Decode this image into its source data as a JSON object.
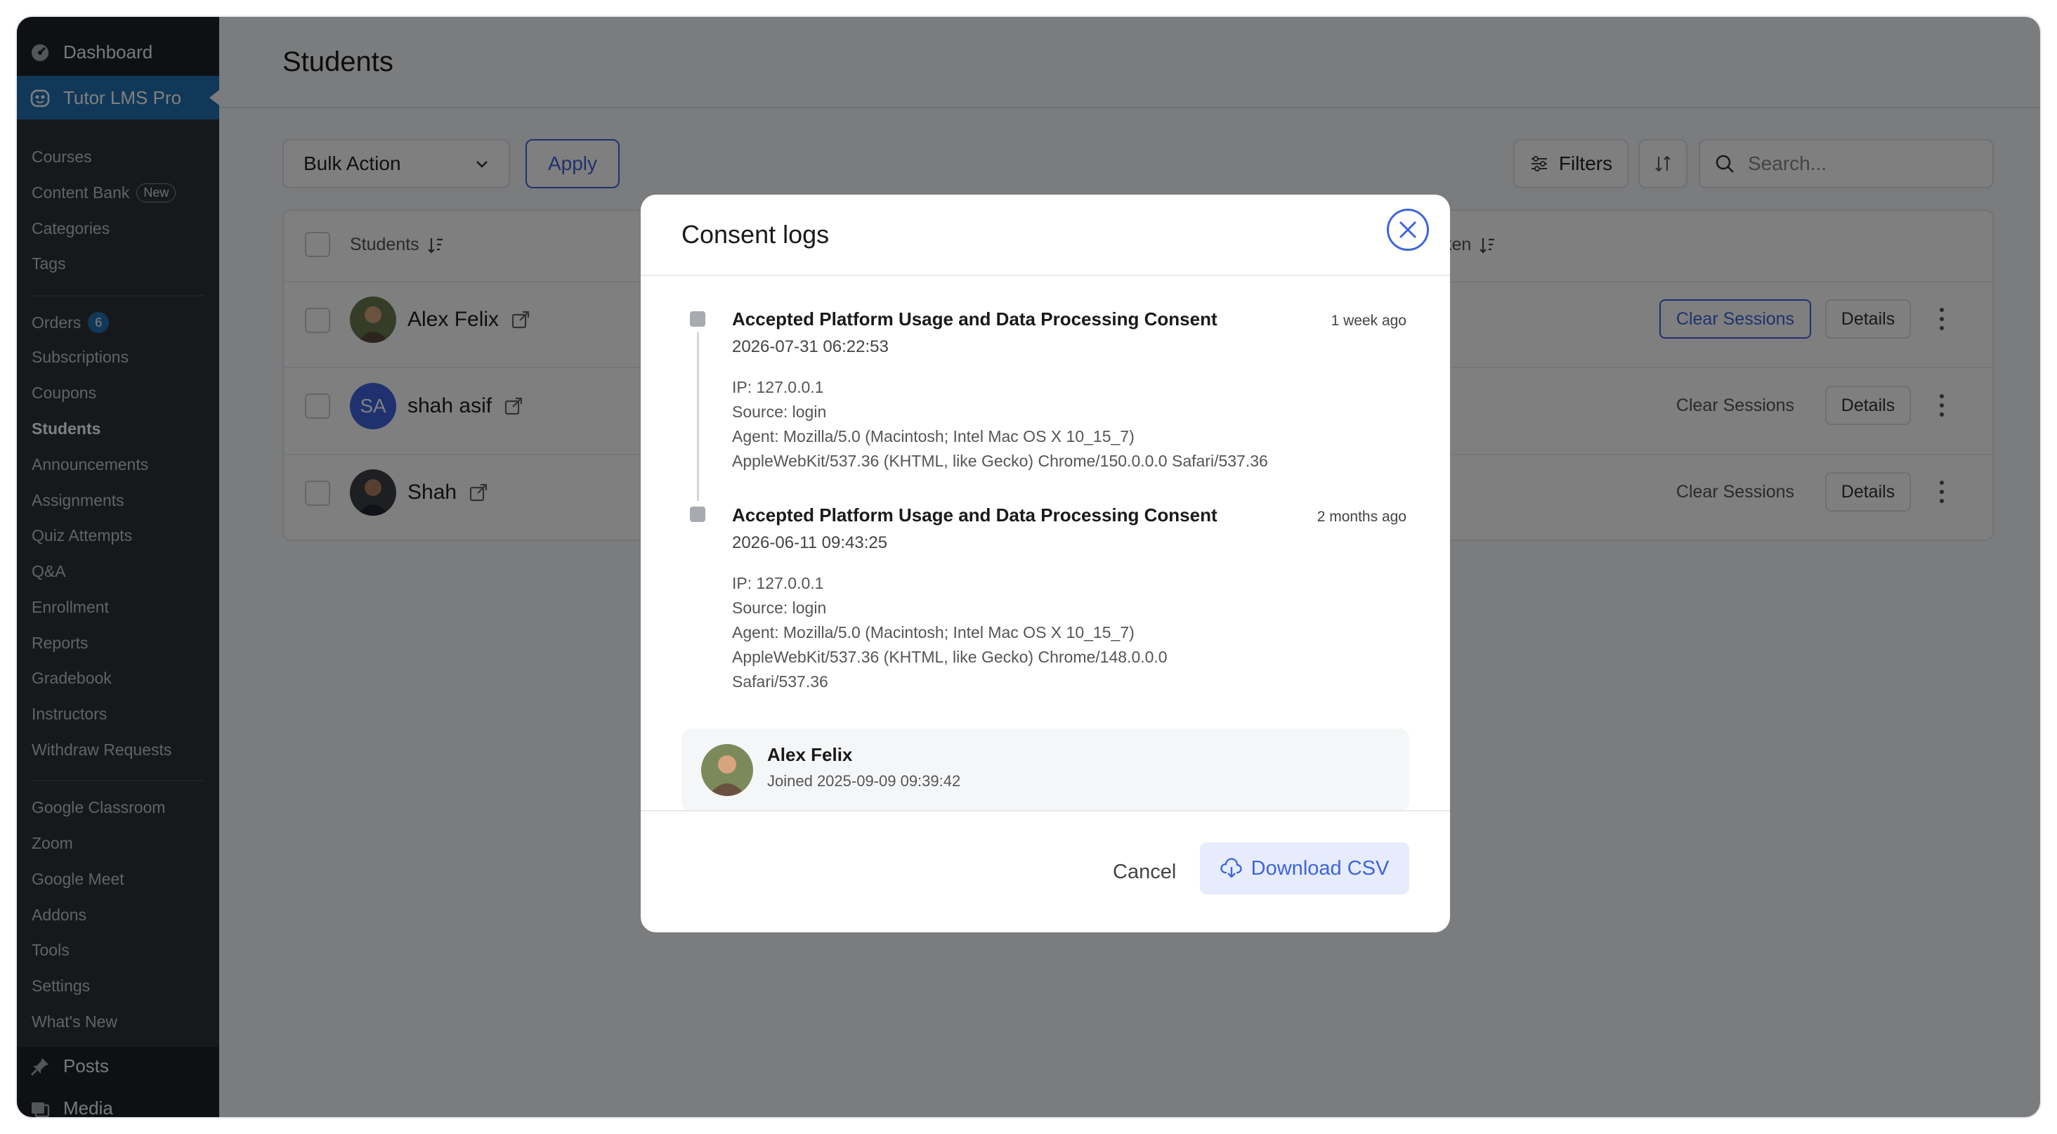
{
  "sidebar": {
    "dashboard": "Dashboard",
    "tutor": "Tutor LMS Pro",
    "items": [
      {
        "label": "Courses"
      },
      {
        "label": "Content Bank",
        "badge": "New"
      },
      {
        "label": "Categories"
      },
      {
        "label": "Tags"
      },
      {
        "label": "Orders",
        "count": "6"
      },
      {
        "label": "Subscriptions"
      },
      {
        "label": "Coupons"
      },
      {
        "label": "Students"
      },
      {
        "label": "Announcements"
      },
      {
        "label": "Assignments"
      },
      {
        "label": "Quiz Attempts"
      },
      {
        "label": "Q&A"
      },
      {
        "label": "Enrollment"
      },
      {
        "label": "Reports"
      },
      {
        "label": "Gradebook"
      },
      {
        "label": "Instructors"
      },
      {
        "label": "Withdraw Requests"
      },
      {
        "label": "Google Classroom"
      },
      {
        "label": "Zoom"
      },
      {
        "label": "Google Meet"
      },
      {
        "label": "Addons"
      },
      {
        "label": "Tools"
      },
      {
        "label": "Settings"
      },
      {
        "label": "What's New"
      }
    ],
    "posts": "Posts",
    "media": "Media"
  },
  "page": {
    "title": "Students",
    "bulk_action": "Bulk Action",
    "apply": "Apply",
    "filters": "Filters",
    "search_placeholder": "Search...",
    "col_students": "Students",
    "col_partial": "ken"
  },
  "students": [
    {
      "name": "Alex Felix",
      "clear": "Clear Sessions",
      "details": "Details"
    },
    {
      "name": "shah asif",
      "initials": "SA",
      "clear": "Clear Sessions",
      "details": "Details"
    },
    {
      "name": "Shah",
      "clear": "Clear Sessions",
      "details": "Details"
    }
  ],
  "modal": {
    "title": "Consent logs",
    "logs": [
      {
        "title": "Accepted Platform Usage and Data Processing Consent",
        "date": "2026-07-31 06:22:53",
        "ago": "1 week ago",
        "ip": "IP: 127.0.0.1",
        "source": "Source: login",
        "agent1": "Agent: Mozilla/5.0 (Macintosh; Intel Mac OS X 10_15_7)",
        "agent2": "AppleWebKit/537.36 (KHTML, like Gecko) Chrome/150.0.0.0 Safari/537.36"
      },
      {
        "title": "Accepted Platform Usage and Data Processing Consent",
        "date": "2026-06-11 09:43:25",
        "ago": "2 months ago",
        "ip": "IP: 127.0.0.1",
        "source": "Source: login",
        "agent1": "Agent: Mozilla/5.0 (Macintosh; Intel Mac OS X 10_15_7)",
        "agent2": "AppleWebKit/537.36 (KHTML, like Gecko) Chrome/148.0.0.0",
        "agent3": "Safari/537.36"
      }
    ],
    "user": {
      "name": "Alex Felix",
      "joined": "Joined 2025-09-09 09:39:42"
    },
    "cancel": "Cancel",
    "download": "Download CSV"
  }
}
